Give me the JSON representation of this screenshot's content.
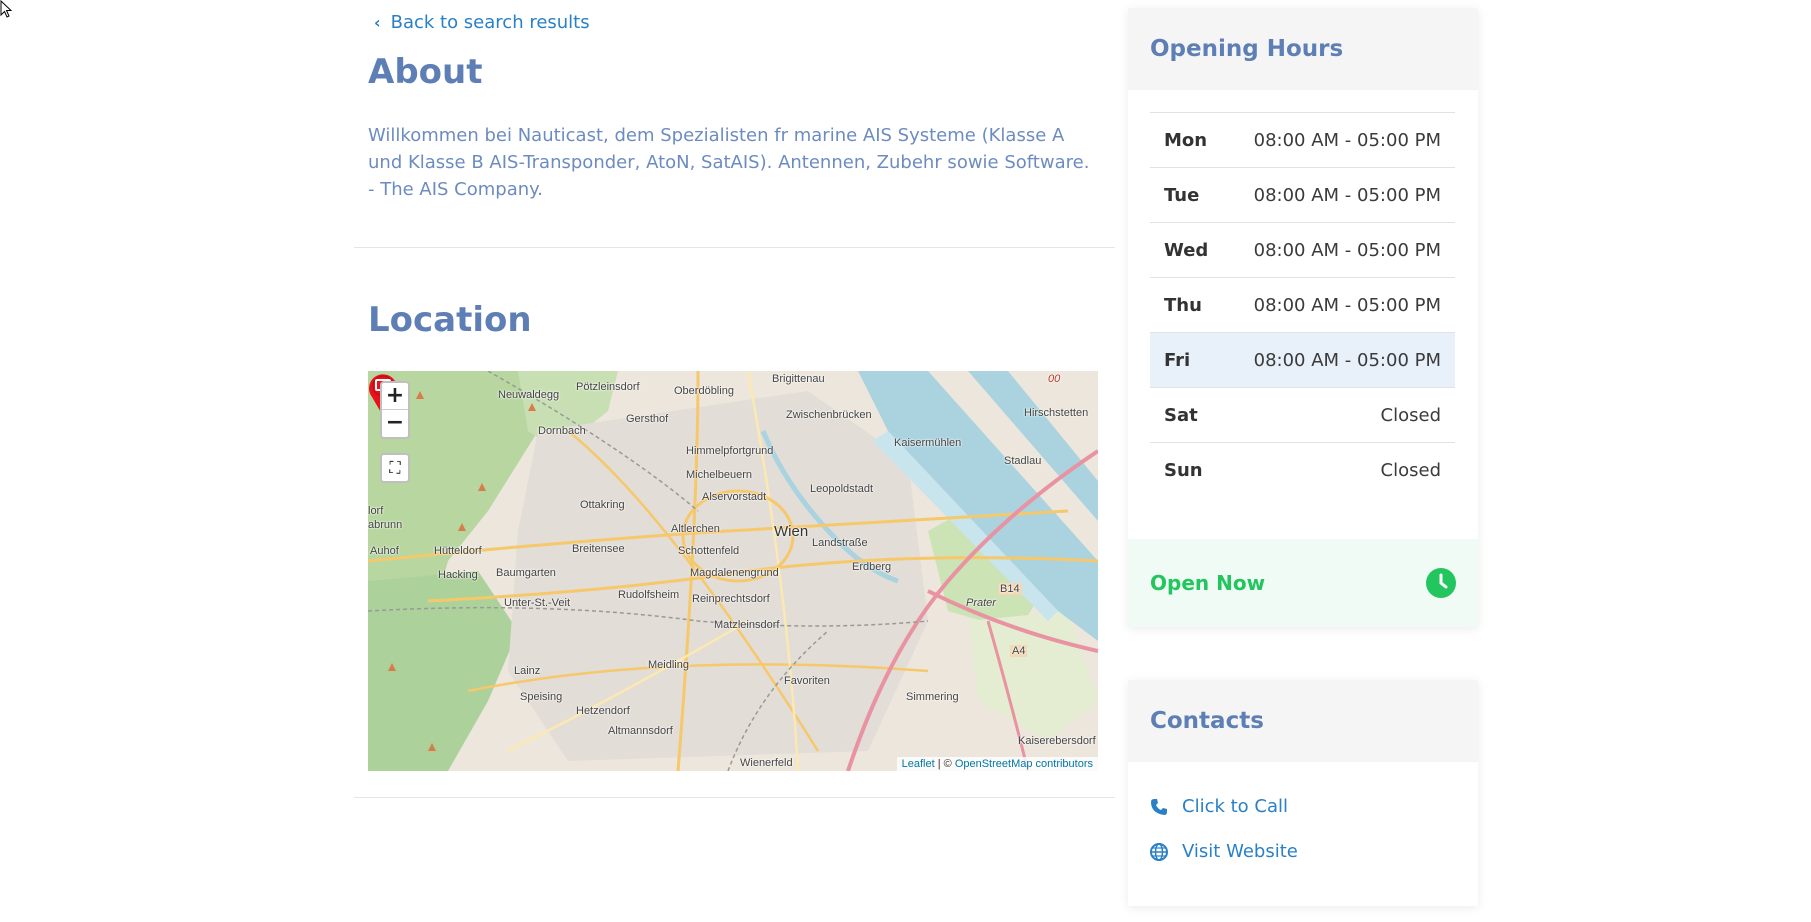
{
  "back_link": {
    "label": "Back to search results",
    "icon": "chevron-left-icon"
  },
  "about": {
    "title": "About",
    "text": "Willkommen bei Nauticast, dem Spezialisten fr marine AIS Systeme (Klasse A und Klasse B AIS-Transponder, AtoN, SatAIS). Antennen, Zubehr sowie Software. - The AIS Company."
  },
  "location": {
    "title": "Location",
    "map": {
      "zoom_in": "+",
      "zoom_out": "−",
      "fullscreen_icon": "fullscreen-icon",
      "attribution_leaflet": "Leaflet",
      "attribution_sep": " | © ",
      "attribution_osm": "OpenStreetMap contributors",
      "labels": {
        "brigittenau": "Brigittenau",
        "poetzleinsdorf": "Pötzleinsdorf",
        "oberdoebling": "Oberdöbling",
        "neuwaldegg": "Neuwaldegg",
        "gersthof": "Gersthof",
        "zwischenbruecken": "Zwischenbrücken",
        "hirschstetten": "Hirschstetten",
        "dornbach": "Dornbach",
        "himmelpfortgrund": "Himmelpfortgrund",
        "kaisermuehlen": "Kaisermühlen",
        "michelbeuern": "Michelbeuern",
        "stadlau": "Stadlau",
        "alservorstadt": "Alservorstadt",
        "leopoldstadt": "Leopoldstadt",
        "ottakring": "Ottakring",
        "wien": "Wien",
        "altlerchenfeld": "Altlerchen",
        "lorf": "lorf",
        "abrunn": "abrunn",
        "auhof": "Auhof",
        "huetteldorf": "Hütteldorf",
        "breitensee": "Breitensee",
        "schottenfeld": "Schottenfeld",
        "landstrasse": "Landstraße",
        "erdberg": "Erdberg",
        "hacking": "Hacking",
        "baumgarten": "Baumgarten",
        "magdalenengrund": "Magdalenengrund",
        "b14": "B14",
        "prater": "Prater",
        "rudolfsheim": "Rudolfsheim",
        "unter_st_veit": "Unter-St.-Veit",
        "reinprechtsdorf": "Reinprechtsdorf",
        "matzleinsdorf": "Matzleinsdorf",
        "a4": "A4",
        "lainz": "Lainz",
        "meidling": "Meidling",
        "favoriten": "Favoriten",
        "speising": "Speising",
        "simmering": "Simmering",
        "hetzendorf": "Hetzendorf",
        "altmannsdorf": "Altmannsdorf",
        "kaiserebersdorf": "Kaiserebersdorf",
        "wienerfeld": "Wienerfeld",
        "oo": "00"
      }
    }
  },
  "opening_hours": {
    "title": "Opening Hours",
    "rows": [
      {
        "day": "Mon",
        "hours": "08:00 AM - 05:00 PM"
      },
      {
        "day": "Tue",
        "hours": "08:00 AM - 05:00 PM"
      },
      {
        "day": "Wed",
        "hours": "08:00 AM - 05:00 PM"
      },
      {
        "day": "Thu",
        "hours": "08:00 AM - 05:00 PM"
      },
      {
        "day": "Fri",
        "hours": "08:00 AM - 05:00 PM",
        "today": true
      },
      {
        "day": "Sat",
        "hours": "Closed"
      },
      {
        "day": "Sun",
        "hours": "Closed"
      }
    ],
    "status": "Open Now",
    "status_icon": "clock-icon",
    "status_color": "#22c55e"
  },
  "contacts": {
    "title": "Contacts",
    "call": {
      "label": "Click to Call",
      "icon": "phone-icon"
    },
    "website": {
      "label": "Visit Website",
      "icon": "globe-icon"
    }
  },
  "colors": {
    "heading": "#5e7fb5",
    "link": "#2a80c7",
    "today_row": "#e8f0fa",
    "open_bg": "#f1fbf5"
  }
}
